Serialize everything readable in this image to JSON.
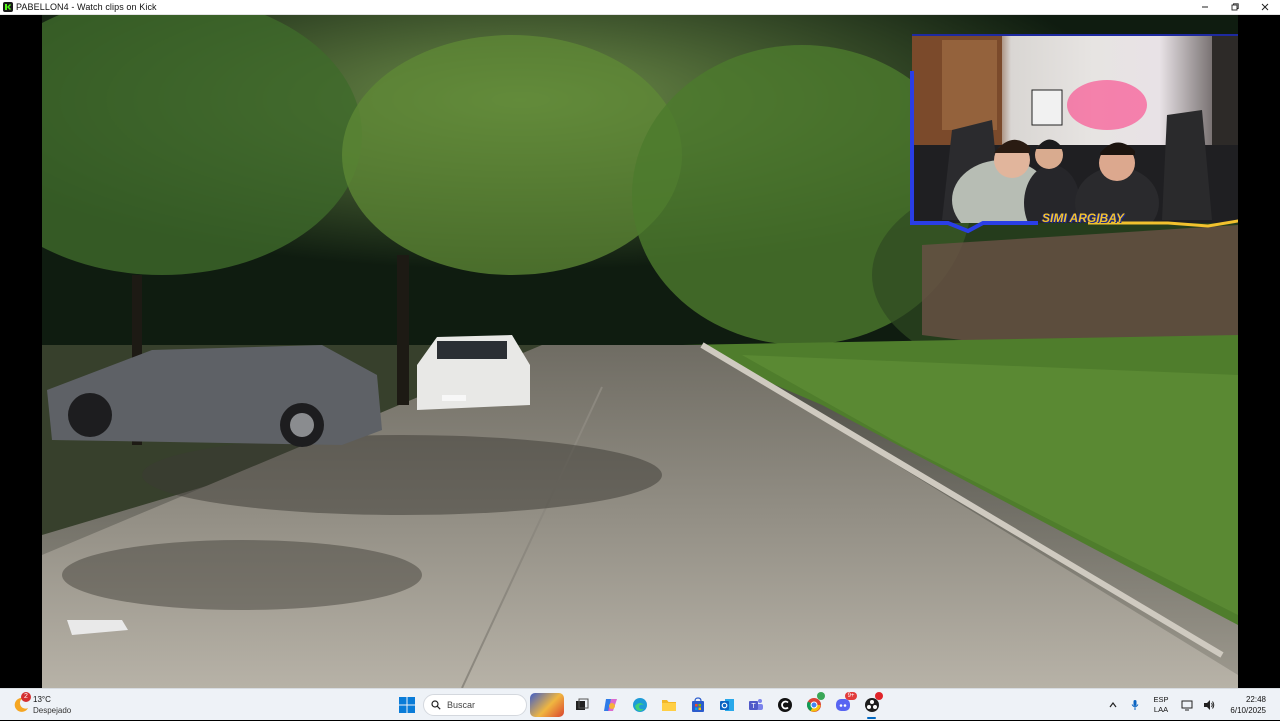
{
  "window": {
    "title": "PABELLON4 - Watch clips on Kick",
    "controls": [
      "minimize-icon",
      "maximize-icon",
      "close-icon"
    ]
  },
  "video": {
    "overlay_logo_text": "SIMI ARGIBAY"
  },
  "taskbar": {
    "weather": {
      "temperature": "13°C",
      "condition": "Despejado",
      "badge": "2"
    },
    "search_placeholder": "Buscar",
    "apps": [
      "start-icon",
      "search-icon",
      "task-view-icon",
      "copilot-icon",
      "edge-icon",
      "file-explorer-icon",
      "store-icon",
      "outlook-icon",
      "teams-icon",
      "app-c-icon",
      "chrome-icon",
      "discord-icon",
      "obs-icon"
    ],
    "discord_badge": "9+",
    "tray": {
      "language": "ESP",
      "layout": "LAA",
      "time": "22:48",
      "date": "6/10/2025"
    }
  }
}
